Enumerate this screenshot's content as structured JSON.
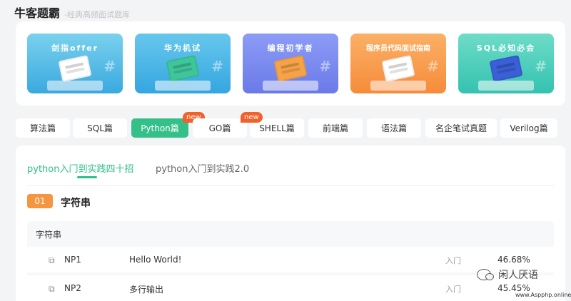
{
  "header": {
    "brand": "牛客题霸",
    "slogan": "-经典高频面试题库"
  },
  "banners": [
    {
      "title": "剑指offer",
      "color_top": "#7ad1ee",
      "color_bottom": "#3aa9df"
    },
    {
      "title": "华为机试",
      "color_top": "#67c7ec",
      "color_bottom": "#35a6e0"
    },
    {
      "title": "编程初学者",
      "color_top": "#8d9cf6",
      "color_bottom": "#6a7ae8"
    },
    {
      "title": "程序员代码面试指南",
      "color_top": "#fbb066",
      "color_bottom": "#f58c3a"
    },
    {
      "title": "SQL必知必会",
      "color_top": "#6edcc8",
      "color_bottom": "#34c2b0"
    }
  ],
  "category_tabs": [
    {
      "label": "算法篇"
    },
    {
      "label": "SQL篇"
    },
    {
      "label": "Python篇",
      "badge": "new",
      "active": true
    },
    {
      "label": "GO篇"
    },
    {
      "label": "SHELL篇",
      "badge": "new"
    },
    {
      "label": "前端篇"
    },
    {
      "label": "语法篇"
    },
    {
      "label": "名企笔试真题"
    },
    {
      "label": "Verilog篇"
    }
  ],
  "sub_tabs": [
    {
      "label": "python入门到实践四十招",
      "active": true
    },
    {
      "label": "python入门到实践2.0"
    }
  ],
  "section": {
    "number": "01",
    "title": "字符串"
  },
  "group": {
    "title": "字符串",
    "rows": [
      {
        "code": "NP1",
        "title": "Hello World!",
        "level": "入门",
        "pass_rate": "46.68%"
      },
      {
        "code": "NP2",
        "title": "多行输出",
        "level": "入门",
        "pass_rate": "45.45%"
      }
    ]
  },
  "watermark": {
    "text": "闲人厌语",
    "url": "www.Aspphp.online"
  },
  "colors": {
    "accent": "#35c08a",
    "badge": "#f2612b",
    "section": "#f5953f"
  }
}
